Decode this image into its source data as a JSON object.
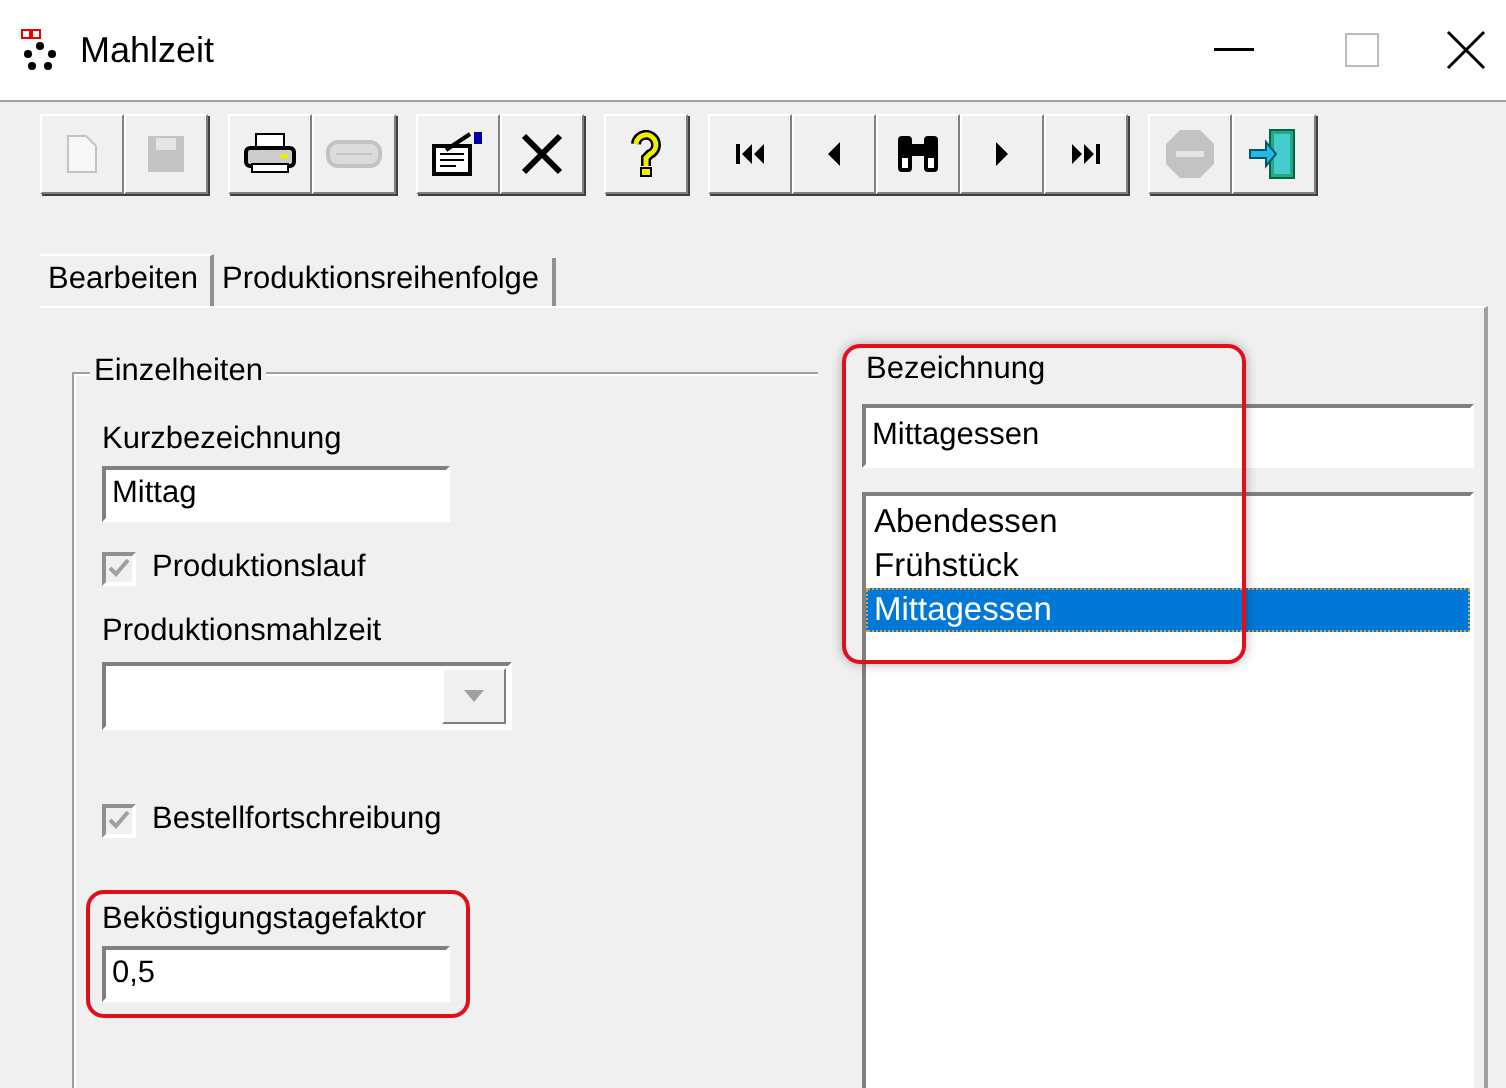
{
  "window": {
    "title": "Mahlzeit"
  },
  "toolbar": [
    [
      {
        "kind": "new",
        "disabled": true
      },
      {
        "kind": "save",
        "disabled": true
      }
    ],
    [
      {
        "kind": "print",
        "disabled": false
      },
      {
        "kind": "blank",
        "disabled": true
      }
    ],
    [
      {
        "kind": "properties",
        "disabled": false
      },
      {
        "kind": "delete",
        "disabled": false
      }
    ],
    [
      {
        "kind": "help",
        "disabled": false
      }
    ],
    [
      {
        "kind": "first",
        "disabled": false
      },
      {
        "kind": "prev",
        "disabled": false
      },
      {
        "kind": "find",
        "disabled": false
      },
      {
        "kind": "next",
        "disabled": false
      },
      {
        "kind": "last",
        "disabled": false
      }
    ],
    [
      {
        "kind": "stop",
        "disabled": true
      },
      {
        "kind": "exit",
        "disabled": false
      }
    ]
  ],
  "tabs": [
    {
      "label": "Bearbeiten",
      "selected": true
    },
    {
      "label": "Produktionsreihenfolge",
      "selected": false
    }
  ],
  "details": {
    "title": "Einzelheiten",
    "short_name": {
      "label": "Kurzbezeichnung",
      "value": "Mittag"
    },
    "production_run": {
      "label": "Produktionslauf",
      "checked": true,
      "disabled": true
    },
    "production_meal": {
      "label": "Produktionsmahlzeit",
      "disabled": true
    },
    "order_update": {
      "label": "Bestellfortschreibung",
      "checked": true,
      "disabled": true
    },
    "boarding_day_factor": {
      "label": "Beköstigungstagefaktor",
      "value": "0,5",
      "highlighted": true
    }
  },
  "designation": {
    "label": "Bezeichnung",
    "value": "Mittagessen",
    "highlighted": true,
    "items": [
      {
        "label": "Abendessen",
        "selected": false
      },
      {
        "label": "Frühstück",
        "selected": false
      },
      {
        "label": "Mittagessen",
        "selected": true
      }
    ]
  }
}
